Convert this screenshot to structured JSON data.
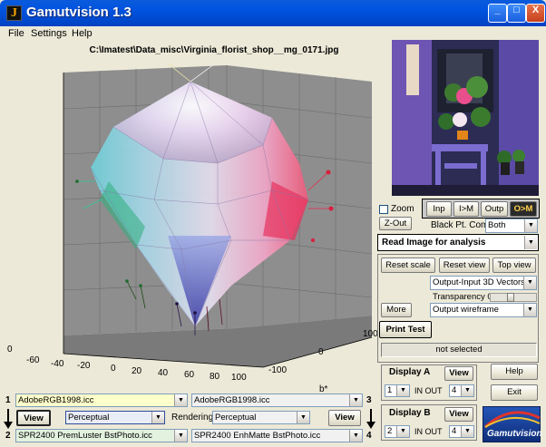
{
  "window": {
    "title": "Gamutvision 1.3",
    "app_icon_glyph": "J",
    "minimize": "_",
    "maximize": "□",
    "close": "X"
  },
  "menu": {
    "items": [
      "File",
      "Settings",
      "Help"
    ]
  },
  "plot": {
    "title": "C:\\Imatest\\Data_misc\\Virginia_florist_shop__mg_0171.jpg",
    "axis_a_ticks": [
      "-60",
      "-40",
      "-20",
      "0",
      "20",
      "40",
      "60",
      "80",
      "100"
    ],
    "axis_b_ticks": [
      "100",
      "0",
      "-100"
    ],
    "axis_b_label": "b*",
    "z_tick": "0"
  },
  "view_controls": {
    "zoom_label": "Zoom",
    "buttons": [
      "Inp",
      "I>M",
      "Outp",
      "O>M"
    ],
    "zout": "Z-Out",
    "black_pt_label": "Black Pt. Comp.",
    "black_pt_value": "Both",
    "read_image": "Read Image for analysis"
  },
  "panel": {
    "reset_scale": "Reset scale",
    "reset_view": "Reset view",
    "top_view": "Top view",
    "display_type": "Output-Input 3D Vectors",
    "transparency_label": "Transparency 0.4",
    "transparency": 0.4,
    "more": "More",
    "wireframe": "Output wireframe",
    "print_test": "Print Test",
    "status": "not selected"
  },
  "display_a": {
    "label": "Display A",
    "view": "View",
    "in_value": "1",
    "in_out": "IN OUT",
    "out_value": "4"
  },
  "display_b": {
    "label": "Display B",
    "view": "View",
    "in_value": "2",
    "in_out": "IN OUT",
    "out_value": "4"
  },
  "side_buttons": {
    "help": "Help",
    "exit": "Exit"
  },
  "brand": "Gamutvision",
  "profiles": {
    "n1": "1",
    "n2": "2",
    "n3": "3",
    "n4": "4",
    "p1": "AdobeRGB1998.icc",
    "p3": "AdobeRGB1998.icc",
    "p2": "SPR2400 PremLuster BstPhoto.icc",
    "p4": "SPR2400 EnhMatte BstPhoto.icc",
    "view_left": "View",
    "view_right": "View",
    "intent_left": "Perceptual",
    "rendering_label": "Rendering",
    "intent_right": "Perceptual"
  }
}
